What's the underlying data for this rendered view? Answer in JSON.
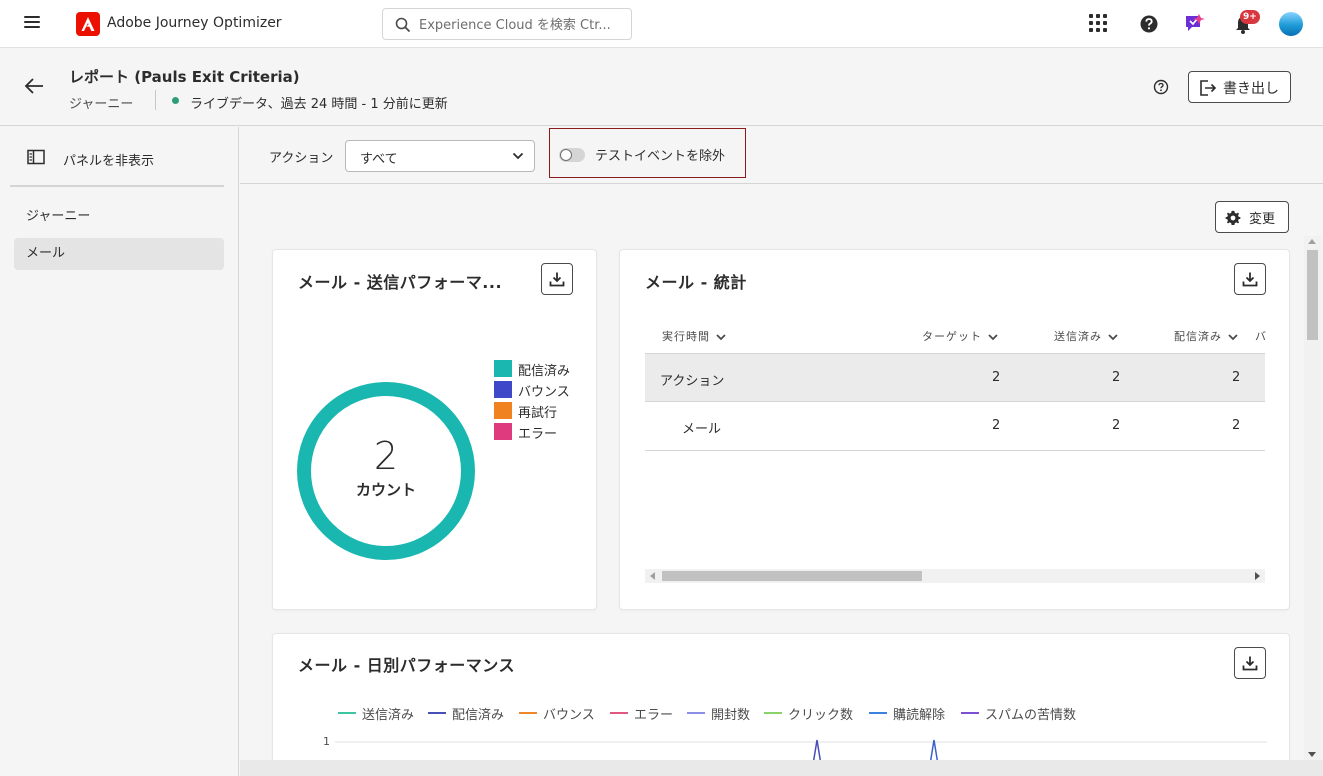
{
  "app": {
    "title": "Adobe Journey Optimizer",
    "search_placeholder": "Experience Cloud を検索 Ctr...",
    "notification_badge": "9+"
  },
  "header": {
    "title": "レポート (Pauls Exit Criteria)",
    "breadcrumb": "ジャーニー",
    "live_status": "ライブデータ、過去 24 時間 - 1 分前に更新",
    "export_label": "書き出し"
  },
  "sidebar": {
    "hide_panel_label": "パネルを非表示",
    "items": [
      {
        "label": "ジャーニー",
        "selected": false
      },
      {
        "label": "メール",
        "selected": true
      }
    ]
  },
  "filters": {
    "action_label": "アクション",
    "action_value": "すべて",
    "exclude_test_label": "テストイベントを除外",
    "exclude_test_on": false
  },
  "toolbar": {
    "change_label": "変更"
  },
  "send_performance": {
    "title": "メール - 送信パフォーマ...",
    "total": "2",
    "total_label": "カウント",
    "legend": [
      {
        "label": "配信済み",
        "color": "#1ab7b0"
      },
      {
        "label": "バウンス",
        "color": "#3f48c8"
      },
      {
        "label": "再試行",
        "color": "#f0821f"
      },
      {
        "label": "エラー",
        "color": "#de3a7d"
      }
    ]
  },
  "stats": {
    "title": "メール - 統計",
    "columns": [
      "実行時間",
      "ターゲット",
      "送信済み",
      "配信済み",
      "バ"
    ],
    "rows": [
      {
        "name": "アクション",
        "target": "2",
        "sent": "2",
        "delivered": "2"
      },
      {
        "name": "メール",
        "target": "2",
        "sent": "2",
        "delivered": "2"
      }
    ]
  },
  "daily": {
    "title": "メール - 日別パフォーマンス",
    "y_tick": "1",
    "legend": [
      {
        "label": "送信済み",
        "color": "#3fc3a5"
      },
      {
        "label": "配信済み",
        "color": "#4650b6"
      },
      {
        "label": "バウンス",
        "color": "#f0882a"
      },
      {
        "label": "エラー",
        "color": "#e0577f"
      },
      {
        "label": "開封数",
        "color": "#8c8fe6"
      },
      {
        "label": "クリック数",
        "color": "#8ad36a"
      },
      {
        "label": "購読解除",
        "color": "#3b82e0"
      },
      {
        "label": "スパムの苦情数",
        "color": "#7e4fd0"
      }
    ]
  }
}
